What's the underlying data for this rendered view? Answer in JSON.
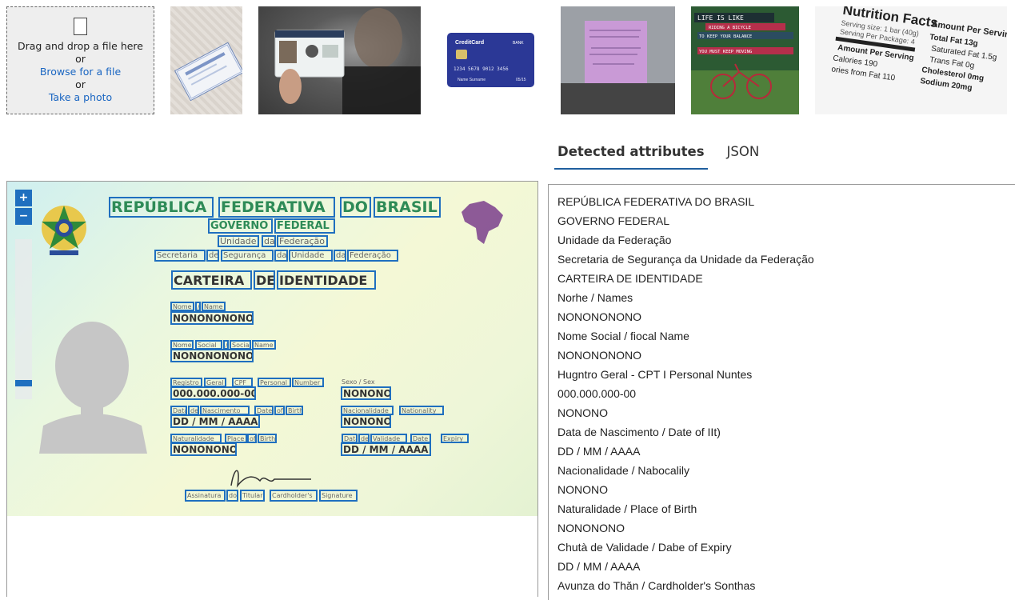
{
  "upload": {
    "drag_text": "Drag and drop a file here",
    "or1": "or",
    "browse_label": "Browse for a file",
    "or2": "or",
    "photo_label": "Take a photo"
  },
  "thumbnails": {
    "card": {
      "brand": "CreditCard",
      "bank": "BANK",
      "number": "1234 5678 9012 3456",
      "name": "Name Surname",
      "expiry": "05/15"
    },
    "poster": {
      "line1": "LIFE IS LIKE",
      "line2": "RIDING A BICYCLE",
      "line3": "TO KEEP YOUR BALANCE",
      "line4": "YOU MUST KEEP MOVING"
    },
    "nutrition": {
      "title": "Nutrition Facts",
      "serving": "Serving size: 1 bar (40g)",
      "per_package": "Serving Per Package: 4",
      "amount": "Amount Per Serving",
      "calories": "Calories 190",
      "fat_cal": "ories from Fat 110",
      "total_fat": "Total Fat 13g",
      "sat_fat": "Saturated Fat 1.5g",
      "trans_fat": "Trans Fat 0g",
      "chol": "Cholesterol 0mg",
      "sodium": "Sodium 20mg"
    }
  },
  "tabs": {
    "attributes": "Detected attributes",
    "json": "JSON"
  },
  "viewer": {
    "zoom_in": "+",
    "zoom_out": "−",
    "zoom_level": 0.12
  },
  "id_card": {
    "republica": "REPÚBLICA",
    "federativa": "FEDERATIVA",
    "do": "DO",
    "brasil": "BRASIL",
    "governo": "GOVERNO",
    "federal": "FEDERAL",
    "unidade": "Unidade",
    "da": "da",
    "federacao": "Federação",
    "secretaria": "Secretaria",
    "de": "de",
    "seguranca": "Segurança",
    "da2": "da",
    "unidade2": "Unidade",
    "da3": "da",
    "federacao2": "Federação",
    "carteira": "CARTEIRA",
    "de2": "DE",
    "identidade": "IDENTIDADE",
    "nome": "Nome",
    "slash1": "/",
    "name": "Name",
    "value_name": "NONONONONO",
    "nome2": "Nome",
    "social": "Social",
    "slash2": "/",
    "social2": "Social",
    "name2": "Name",
    "value_social": "NONONONONO",
    "registro": "Registro",
    "geral": "Geral",
    "cpf": "CPF",
    "personal": "Personal",
    "number": "Number",
    "sexo": "Sexo / Sex",
    "value_cpf": "000.000.000-00",
    "value_sex": "NONONO",
    "data": "Data",
    "de3": "de",
    "nascimento": "Nascimento",
    "date": "Date",
    "of": "of",
    "birth": "Birth",
    "nacionalidade": "Nacionalidade",
    "nationality": "Nationality",
    "value_dob": "DD / MM / AAAA",
    "value_nat": "NONONO",
    "naturalidade": "Naturalidade",
    "place": "Place",
    "of2": "of",
    "birth2": "Birth",
    "data2": "Data",
    "de4": "de",
    "validade": "Validade",
    "date2": "Date",
    "expiry": "Expiry",
    "value_place": "NONONONO",
    "value_exp": "DD / MM / AAAA",
    "assinatura": "Assinatura",
    "do2": "do",
    "titular": "Titular",
    "cardholders": "Cardholder's",
    "signature": "Signature"
  },
  "attributes": [
    "REPÚBLICA FEDERATIVA DO BRASIL",
    "GOVERNO FEDERAL",
    "Unidade da Federação",
    "Secretaria de Segurança da Unidade da Federação",
    "CARTEIRA DE IDENTIDADE",
    "Norhe / Names",
    "NONONONONO",
    "Nome Social / fiocal Name",
    "NONONONONO",
    "Hugntro Geral - CPT I Personal Nuntes",
    "000.000.000-00",
    "NONONO",
    "Data de Nascimento / Date of IIt)",
    "DD / MM / AAAA",
    "Nacionalidade / Nabocalily",
    "NONONO",
    "Naturalidade / Place of Birth",
    "NONONONO",
    "Chutà de Validade / Dabe of Expiry",
    "DD / MM / AAAA",
    "Avunza do Thǎn / Cardholder's Sonthas"
  ]
}
